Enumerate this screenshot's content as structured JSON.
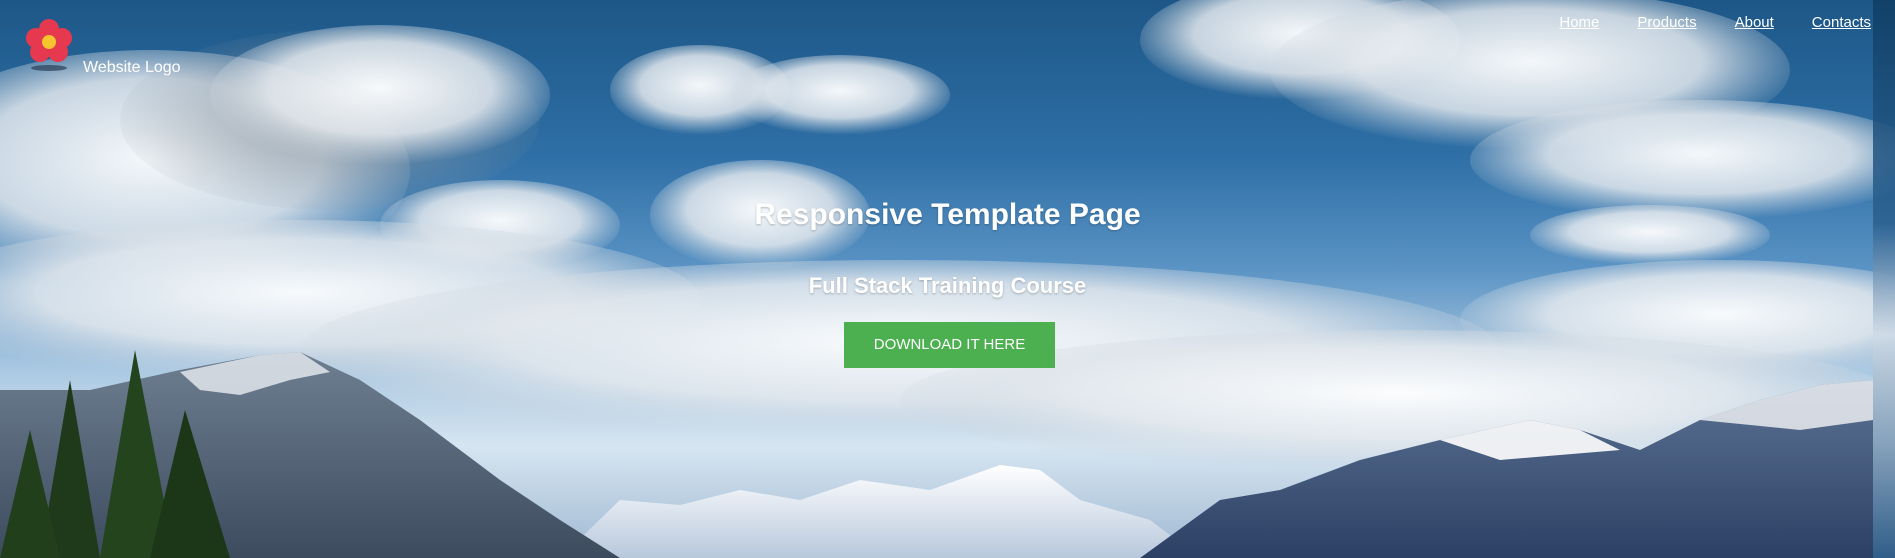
{
  "header": {
    "logo_icon": "flower-icon",
    "logo_text": "Website Logo"
  },
  "nav": {
    "items": [
      "Home",
      "Products",
      "About",
      "Contacts"
    ]
  },
  "hero": {
    "title": "Responsive Template Page",
    "subtitle": "Full Stack Training Course",
    "button_label": "DOWNLOAD IT HERE",
    "background": "mountain-sky-photo",
    "colors": {
      "button": "#4caf50",
      "text": "#ffffff",
      "sky": "#2e6fa6"
    }
  }
}
